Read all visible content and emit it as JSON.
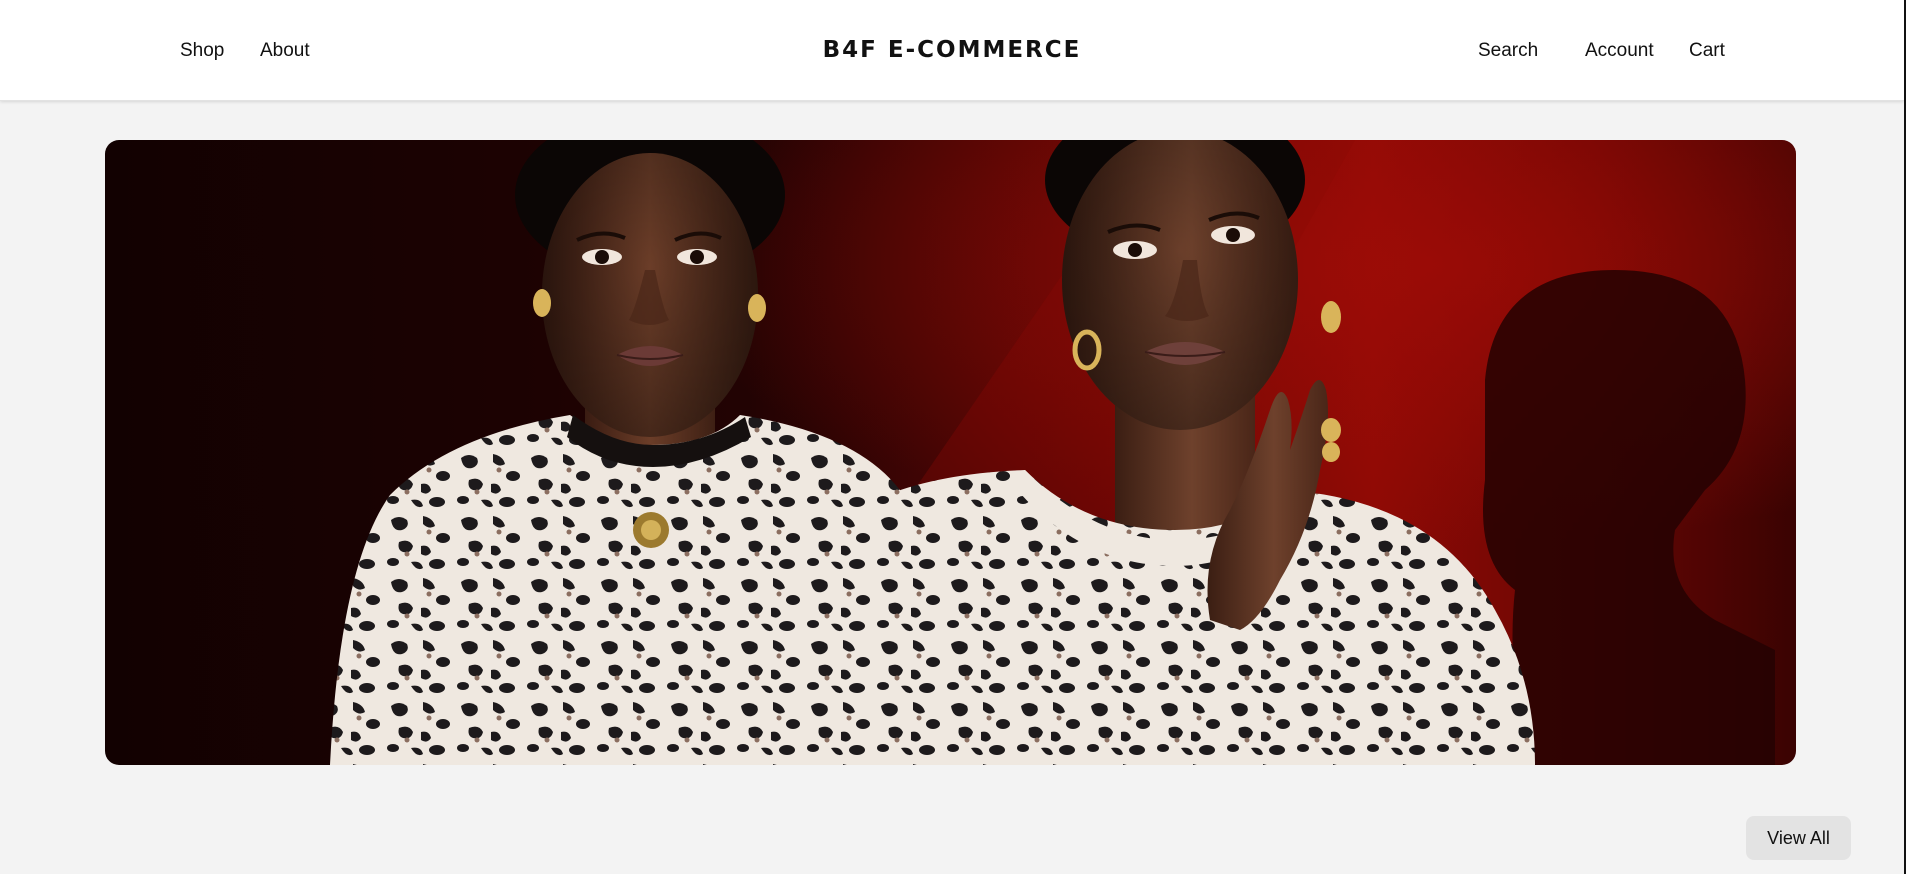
{
  "header": {
    "brand": "B4F E-COMMERCE",
    "nav_left": {
      "shop": "Shop",
      "about": "About"
    },
    "nav_right": {
      "search": "Search",
      "account": "Account",
      "cart": "Cart"
    }
  },
  "hero": {
    "image": "two-models-leopard-print-tops-red-backdrop",
    "colors": {
      "backdrop_dark": "#1a0303",
      "backdrop_red": "#8e0a05",
      "skin": "#5a3322",
      "fabric": "#efe8e0",
      "spots": "#1d1a1c"
    }
  },
  "actions": {
    "view_all": "View All"
  }
}
